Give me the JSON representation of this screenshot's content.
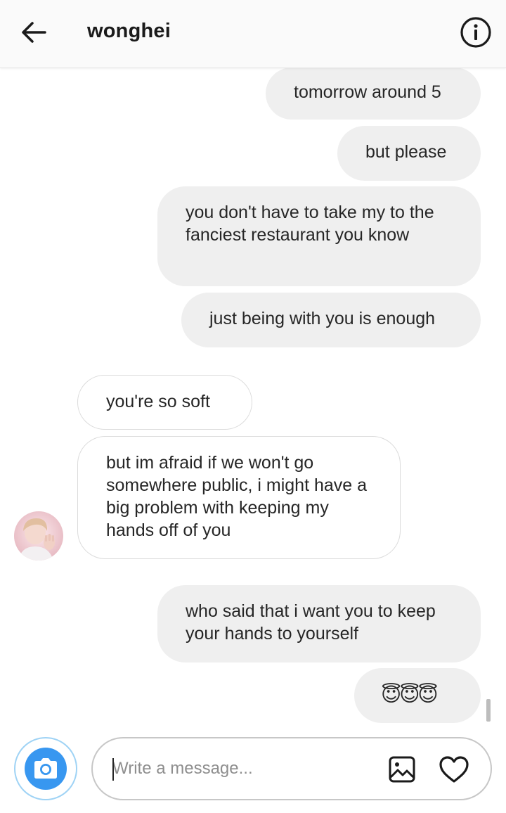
{
  "header": {
    "username": "wonghei",
    "back_icon": "arrow-left-icon",
    "info_icon": "info-icon"
  },
  "messages": [
    {
      "from": "me",
      "text": "tomorrow around 5"
    },
    {
      "from": "me",
      "text": "but please"
    },
    {
      "from": "me",
      "text": "you don't have to take my to the fanciest restaurant you know"
    },
    {
      "from": "me",
      "text": "just being with you is enough"
    },
    {
      "from": "them",
      "text": "you're so soft"
    },
    {
      "from": "them",
      "text": "but im afraid if we won't go somewhere public, i might have a big problem with keeping my hands off of you"
    },
    {
      "from": "me",
      "text": "who said that i want you to keep your hands to yourself"
    },
    {
      "from": "me",
      "text": "😇😇😇"
    }
  ],
  "composer": {
    "placeholder": "Write a message...",
    "value": "",
    "camera_icon": "camera-icon",
    "gallery_icon": "image-icon",
    "like_icon": "heart-icon"
  },
  "colors": {
    "accent": "#3897f0",
    "sent_bubble": "#efefef",
    "received_border": "#dbdbdb"
  }
}
